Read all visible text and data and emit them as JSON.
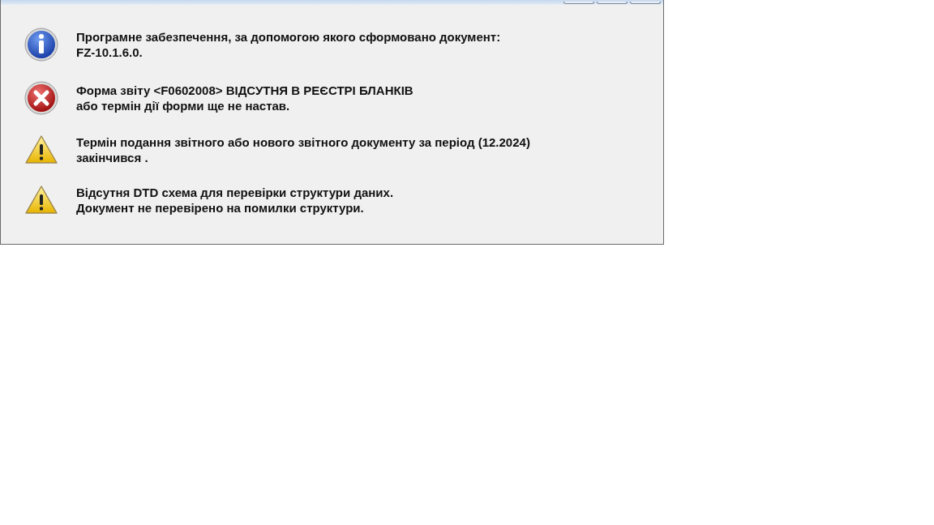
{
  "messages": [
    {
      "kind": "info",
      "lines": [
        "Програмне забезпечення, за допомогою якого сформовано документ:",
        "FZ-10.1.6.0."
      ]
    },
    {
      "kind": "error",
      "lines": [
        "Форма звіту <F0602008> ВІДСУТНЯ В РЕЄСТРІ БЛАНКІВ",
        "або термін дії форми ще не настав."
      ]
    },
    {
      "kind": "warning",
      "lines": [
        "Термін подання звітного або нового звітного документу за період (12.2024)",
        "закінчився ."
      ]
    },
    {
      "kind": "warning",
      "lines": [
        "Відсутня DTD схема для перевірки структури даних.",
        "Документ не перевірено на помилки структури."
      ]
    }
  ]
}
